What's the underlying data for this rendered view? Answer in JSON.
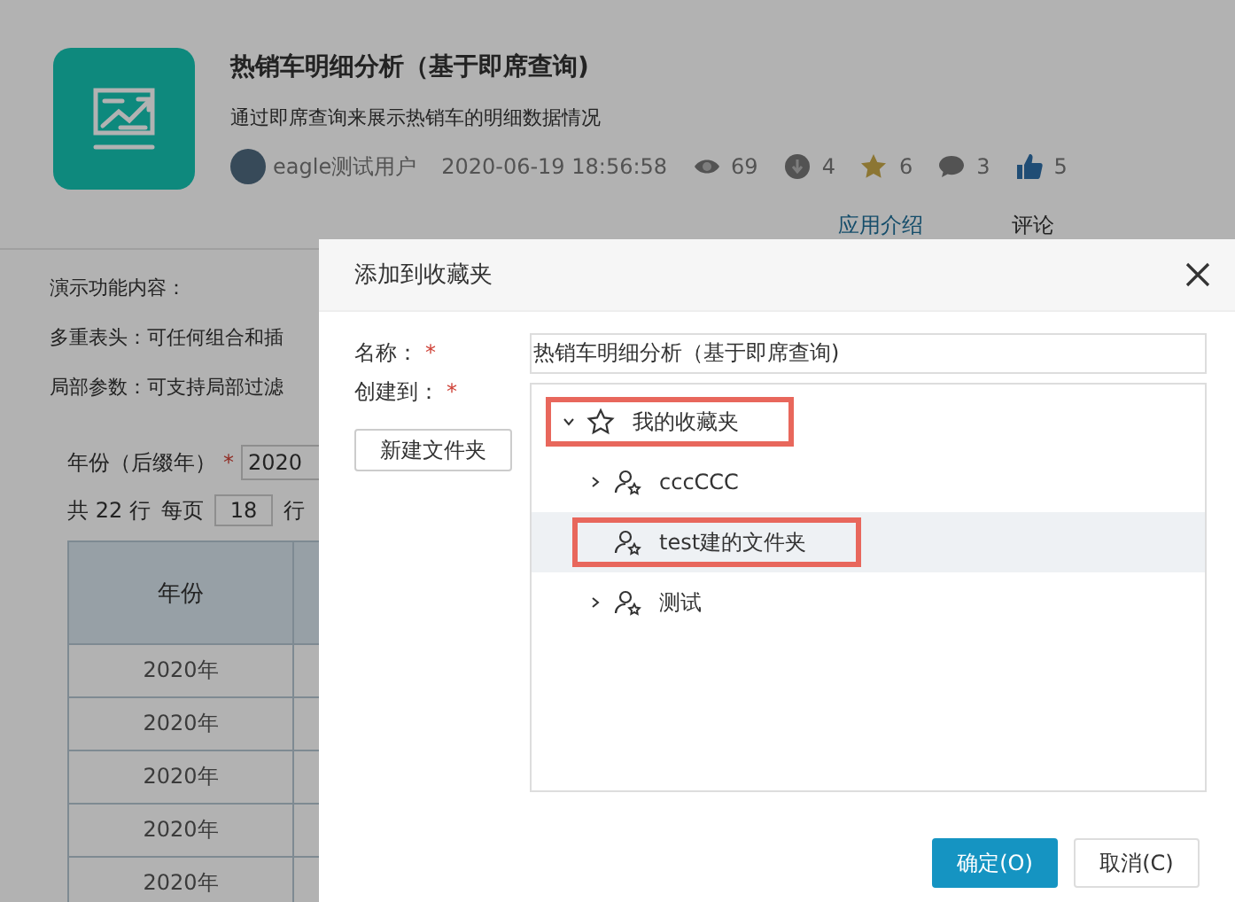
{
  "app": {
    "title": "热销车明细分析（基于即席查询)",
    "description": "通过即席查询来展示热销车的明细数据情况",
    "author": "eagle测试用户",
    "date": "2020-06-19 18:56:58",
    "stats": [
      {
        "kind": "views",
        "count": "69"
      },
      {
        "kind": "downloads",
        "count": "4"
      },
      {
        "kind": "favorites",
        "count": "6"
      },
      {
        "kind": "comments",
        "count": "3"
      },
      {
        "kind": "likes",
        "count": "5"
      }
    ],
    "tabs": [
      {
        "label": "应用介绍",
        "selected": true
      },
      {
        "label": "评论",
        "selected": false
      }
    ]
  },
  "content": {
    "lines": [
      "演示功能内容：",
      "多重表头：可任何组合和插",
      "局部参数：可支持局部过滤"
    ],
    "filter": {
      "label": "年份（后缀年）",
      "required_mark": "*",
      "value": "2020"
    },
    "pagination": {
      "total": "共 22 行",
      "per_page_label": "每页",
      "per_page": "18",
      "unit": "行"
    },
    "table": {
      "columns": [
        "年份",
        ""
      ],
      "rows": [
        [
          "2020年",
          ""
        ],
        [
          "2020年",
          ""
        ],
        [
          "2020年",
          ""
        ],
        [
          "2020年",
          ""
        ],
        [
          "2020年",
          ""
        ]
      ]
    }
  },
  "dialog": {
    "title": "添加到收藏夹",
    "name_field": {
      "label": "名称：",
      "required_mark": "*",
      "value": "热销车明细分析（基于即席查询)"
    },
    "location_field": {
      "label": "创建到：",
      "required_mark": "*"
    },
    "new_folder_button": "新建文件夹",
    "tree": [
      {
        "label": "我的收藏夹",
        "kind": "favorites",
        "expanded": true,
        "selected": false,
        "highlighted": true,
        "children": [
          {
            "label": "cccCCC",
            "kind": "shared",
            "expanded": false,
            "selected": false,
            "highlighted": false
          },
          {
            "label": "test建的文件夹",
            "kind": "shared",
            "selected": true,
            "highlighted": true
          },
          {
            "label": "测试",
            "kind": "shared",
            "expanded": false,
            "selected": false,
            "highlighted": false
          }
        ]
      }
    ],
    "buttons": [
      {
        "label": "确定(O)",
        "kind": "primary"
      },
      {
        "label": "取消(C)",
        "kind": "default"
      }
    ]
  }
}
